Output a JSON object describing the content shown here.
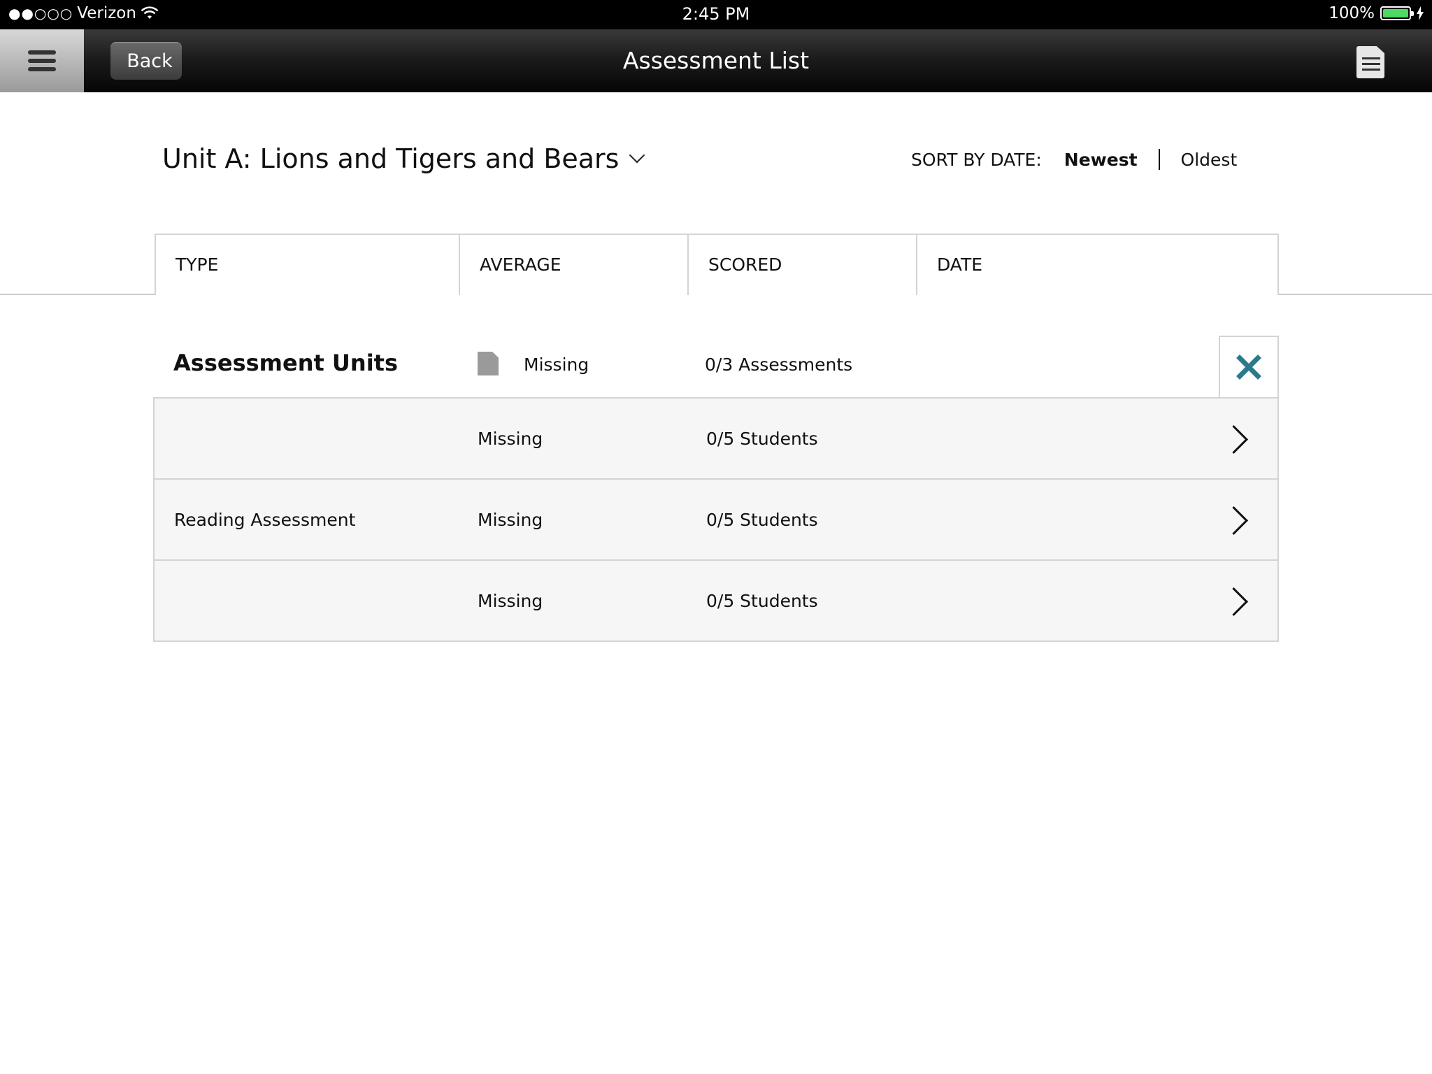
{
  "status_bar": {
    "carrier_dots": "●●○○○",
    "carrier": "Verizon",
    "time": "2:45 PM",
    "battery": "100%"
  },
  "nav": {
    "back_label": "Back",
    "title": "Assessment List",
    "menu_icon": "hamburger-icon",
    "list_icon": "document-list-icon"
  },
  "unit_selector": {
    "value": "Unit A: Lions and Tigers and Bears"
  },
  "sort": {
    "label": "SORT BY DATE:",
    "options": [
      "Newest",
      "Oldest"
    ],
    "selected": "Newest"
  },
  "table": {
    "columns": [
      "TYPE",
      "AVERAGE",
      "SCORED",
      "DATE"
    ],
    "group": {
      "title": "Assessment Units",
      "average": "Missing",
      "scored": "0/3 Assessments",
      "close_icon": "close-x-icon",
      "accent_color": "#2b7a8c"
    },
    "rows": [
      {
        "type": "",
        "average": "Missing",
        "scored": "0/5 Students",
        "date": ""
      },
      {
        "type": "Reading Assessment",
        "average": "Missing",
        "scored": "0/5 Students",
        "date": ""
      },
      {
        "type": "",
        "average": "Missing",
        "scored": "0/5 Students",
        "date": ""
      }
    ]
  }
}
